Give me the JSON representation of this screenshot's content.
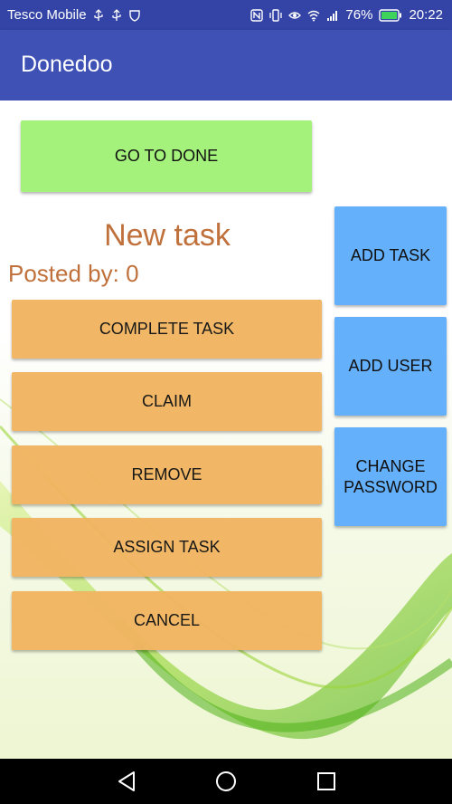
{
  "status_bar": {
    "carrier": "Tesco Mobile",
    "battery": "76%",
    "time": "20:22"
  },
  "app_bar": {
    "title": "Donedoo"
  },
  "main": {
    "go_to_done": "GO TO DONE",
    "task_title": "New task",
    "posted_by": "Posted by: 0",
    "actions": {
      "complete": "COMPLETE TASK",
      "claim": "CLAIM",
      "remove": "REMOVE",
      "assign": "ASSIGN TASK",
      "cancel": "CANCEL"
    },
    "side_actions": {
      "add_task": "ADD TASK",
      "add_user": "ADD USER",
      "change_password": "CHANGE PASSWORD"
    }
  },
  "colors": {
    "app_bar": "#3f51b5",
    "status_bar": "#3444a6",
    "green_button": "#a4f17b",
    "orange_button": "#f1b562",
    "blue_button": "#64b0fb",
    "task_text": "#c0703a"
  },
  "icons": {
    "usb": "usb-icon",
    "shield": "shield-icon",
    "nfc": "nfc-icon",
    "vibrate": "vibrate-icon",
    "eye": "eye-icon",
    "wifi": "wifi-icon",
    "signal": "signal-icon",
    "battery": "battery-icon",
    "back": "back-icon",
    "home": "home-icon",
    "recents": "recents-icon"
  }
}
